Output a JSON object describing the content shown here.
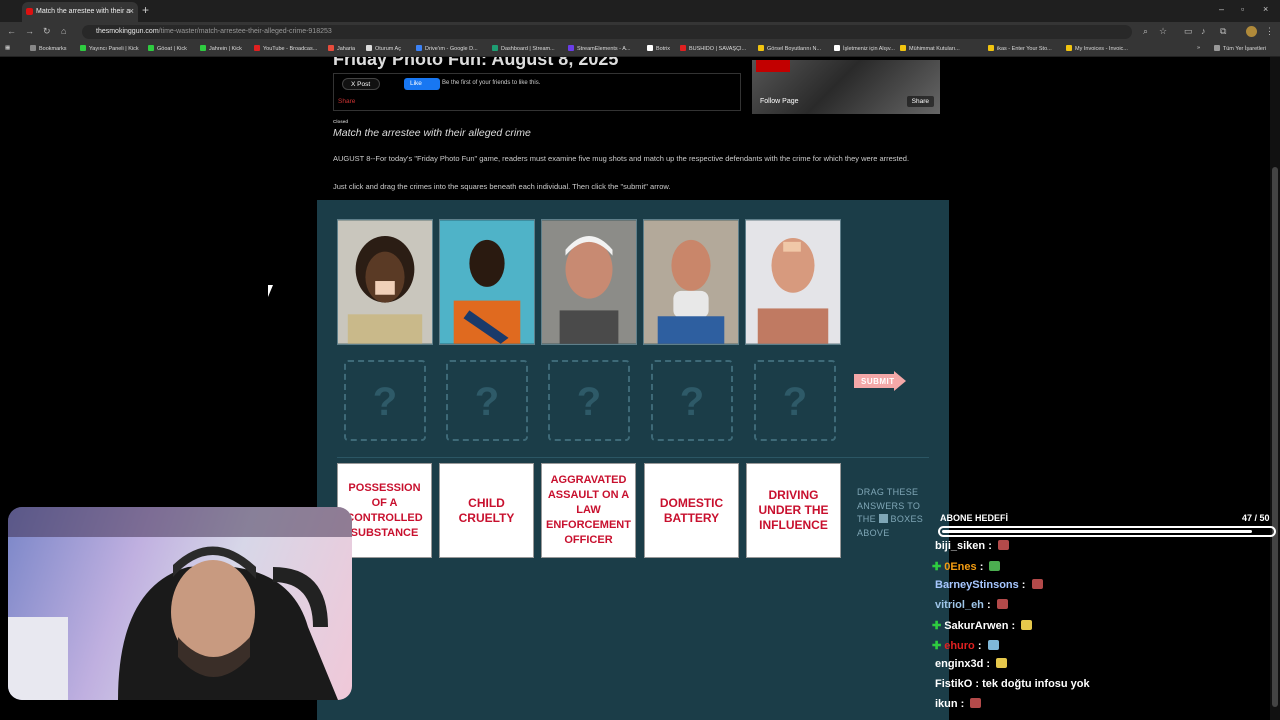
{
  "browser": {
    "tab_title": "Match the arrestee with their a",
    "url_domain": "thesmokinggun.com",
    "url_path": "/time-waster/match-arrestee-their-alleged-crime-918253",
    "bookmarks": [
      "Bookmarks",
      "Yayıncı Paneli | Kick",
      "Göoat | Kick",
      "Jahrein | Kick",
      "YouTube - Broadcas...",
      "Jaharia",
      "Oturum Aç",
      "Drive'ım - Google D...",
      "Dashboard | Stream...",
      "StreamElements - A...",
      "Botrix",
      "BUSHIDO | SAVAŞÇI...",
      "Görsel Boyutlarını N...",
      "İşletmeniz için Alışv...",
      "Mühimmat Kutuları...",
      "ikas - Enter Your Sto...",
      "My Invoices - Invoic..."
    ],
    "other_bookmarks": "Tüm Yer İşaretleri"
  },
  "article": {
    "title": "Friday Photo Fun: August 8, 2025",
    "x_post": "X Post",
    "fb_like": "Like",
    "fb_friends": "Be the first of your friends to like this.",
    "share": "Share",
    "fb_follow": "Follow Page",
    "fb_share": "Share",
    "closed": "Closed",
    "subhead": "Match the arrestee with their alleged crime",
    "intro": "AUGUST 8--For today's \"Friday Photo Fun\" game, readers must examine five mug shots and match up the respective defendants with the crime for which they were arrested.",
    "instructions": "Just click and drag the crimes into the squares beneath each individual. Then click the \"submit\" arrow."
  },
  "game": {
    "slots": [
      "?",
      "?",
      "?",
      "?",
      "?"
    ],
    "submit": "SUBMIT",
    "crimes": [
      "POSSESSION OF A CONTROLLED SUBSTANCE",
      "CHILD CRUELTY",
      "AGGRAVATED ASSAULT ON A LAW ENFORCEMENT OFFICER",
      "DOMESTIC BATTERY",
      "DRIVING UNDER THE INFLUENCE"
    ],
    "hint_pre": "DRAG THESE ANSWERS TO THE",
    "hint_post": "BOXES ABOVE"
  },
  "stream": {
    "goal_label": "ABONE HEDEFİ",
    "goal_count": "47 / 50",
    "goal_fraction": 0.94,
    "chat": [
      {
        "user": "biji_siken",
        "color": "#ffffff",
        "star": false,
        "text": "",
        "emote": "#b34a4a"
      },
      {
        "user": "0Enes",
        "color": "#f39c12",
        "star": true,
        "text": "",
        "emote": "#4caf50"
      },
      {
        "user": "BarneyStinsons",
        "color": "#a7c7ff",
        "star": false,
        "text": "",
        "emote": "#b34a4a"
      },
      {
        "user": "vitriol_eh",
        "color": "#9ec5e8",
        "star": false,
        "text": "",
        "emote": "#b34a4a"
      },
      {
        "user": "SakurArwen",
        "color": "#ffffff",
        "star": true,
        "text": "",
        "emote": "#e6c84c"
      },
      {
        "user": "ehuro",
        "color": "#e02020",
        "star": true,
        "text": "",
        "emote": "#7fb8d8"
      },
      {
        "user": "enginx3d",
        "color": "#ffffff",
        "star": false,
        "text": "",
        "emote": "#e6c84c"
      },
      {
        "user": "FistikO",
        "color": "#ffffff",
        "star": false,
        "text": "tek doğtu infosu yok",
        "emote": ""
      },
      {
        "user": "ikun",
        "color": "#ffffff",
        "star": false,
        "text": "",
        "emote": "#b34a4a"
      }
    ]
  }
}
